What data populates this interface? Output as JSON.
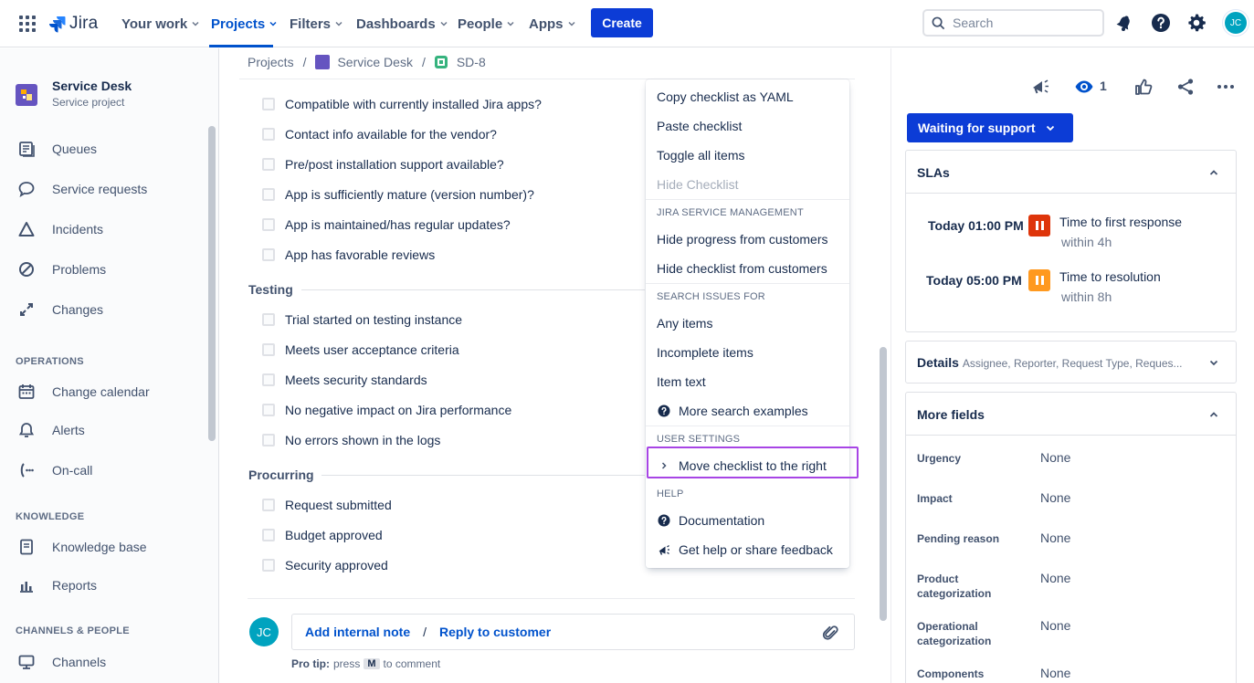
{
  "topnav": {
    "logo_text": "Jira",
    "items": [
      {
        "label": "Your work"
      },
      {
        "label": "Projects"
      },
      {
        "label": "Filters"
      },
      {
        "label": "Dashboards"
      },
      {
        "label": "People"
      },
      {
        "label": "Apps"
      }
    ],
    "create_label": "Create",
    "search_placeholder": "Search",
    "avatar_initials": "JC"
  },
  "sidebar": {
    "project_name": "Service Desk",
    "project_type": "Service project",
    "items": [
      {
        "label": "Queues"
      },
      {
        "label": "Service requests"
      },
      {
        "label": "Incidents"
      },
      {
        "label": "Problems"
      },
      {
        "label": "Changes"
      }
    ],
    "operations_heading": "OPERATIONS",
    "operations_items": [
      {
        "label": "Change calendar"
      },
      {
        "label": "Alerts"
      },
      {
        "label": "On-call"
      }
    ],
    "knowledge_heading": "KNOWLEDGE",
    "knowledge_items": [
      {
        "label": "Knowledge base"
      },
      {
        "label": "Reports"
      }
    ],
    "channels_heading": "CHANNELS & PEOPLE",
    "channels_items": [
      {
        "label": "Channels"
      }
    ]
  },
  "breadcrumb": {
    "projects": "Projects",
    "sep": "/",
    "project": "Service Desk",
    "issue": "SD-8"
  },
  "checklist": {
    "top_items": [
      "Compatible with currently installed Jira apps?",
      "Contact info available for the vendor?",
      "Pre/post installation support available?",
      "App is sufficiently mature (version number)?",
      "App is maintained/has regular updates?",
      "App has favorable reviews"
    ],
    "testing_title": "Testing",
    "testing_items": [
      "Trial started on testing instance",
      "Meets user acceptance criteria",
      "Meets security standards",
      "No negative impact on Jira performance",
      "No errors shown in the logs"
    ],
    "procurring_title": "Procurring",
    "procurring_items": [
      "Request submitted",
      "Budget approved",
      "Security approved"
    ]
  },
  "comment": {
    "avatar_initials": "JC",
    "internal_note": "Add internal note",
    "slash": "/",
    "reply": "Reply to customer",
    "protip_label": "Pro tip:",
    "protip_press": "press",
    "protip_key": "M",
    "protip_rest": "to comment"
  },
  "menu": {
    "items_1": [
      "Copy checklist as YAML",
      "Paste checklist",
      "Toggle all items"
    ],
    "hide_checklist": "Hide Checklist",
    "jsm_heading": "JIRA SERVICE MANAGEMENT",
    "jsm_items": [
      "Hide progress from customers",
      "Hide checklist from customers"
    ],
    "search_heading": "SEARCH ISSUES FOR",
    "search_items": [
      "Any items",
      "Incomplete items",
      "Item text"
    ],
    "more_search": "More search examples",
    "user_heading": "USER SETTINGS",
    "move_right": "Move checklist to the right",
    "help_heading": "HELP",
    "documentation": "Documentation",
    "feedback": "Get help or share feedback"
  },
  "right_panel": {
    "watch_count": "1",
    "status": "Waiting for support",
    "slas_title": "SLAs",
    "slas": [
      {
        "time": "Today 01:00 PM",
        "name": "Time to first response",
        "within": "within 4h",
        "color": "#DE350B"
      },
      {
        "time": "Today 05:00 PM",
        "name": "Time to resolution",
        "within": "within 8h",
        "color": "#FF991F"
      }
    ],
    "details_title": "Details",
    "details_sub": "Assignee, Reporter, Request Type, Reques...",
    "more_fields_title": "More fields",
    "fields": [
      {
        "label": "Urgency",
        "value": "None"
      },
      {
        "label": "Impact",
        "value": "None"
      },
      {
        "label": "Pending reason",
        "value": "None"
      },
      {
        "label": "Product categorization",
        "value": "None"
      },
      {
        "label": "Operational categorization",
        "value": "None"
      },
      {
        "label": "Components",
        "value": "None"
      }
    ]
  },
  "colors": {
    "brand_blue": "#0C3CD6",
    "link_blue": "#0052CC",
    "highlight_purple": "#A745E5"
  }
}
